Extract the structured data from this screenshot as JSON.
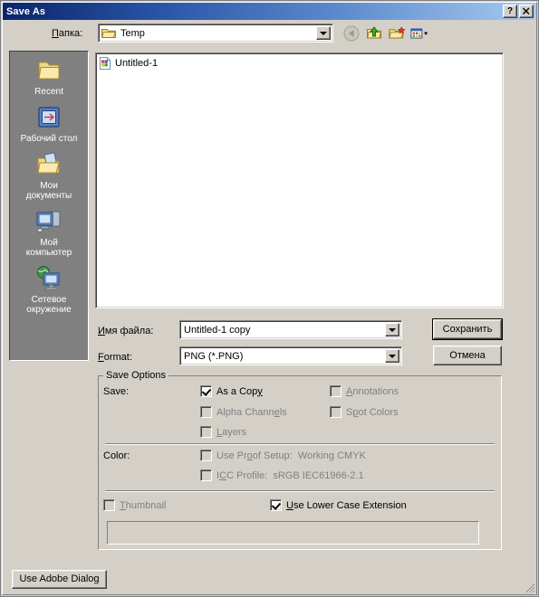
{
  "window": {
    "title": "Save As",
    "help_button": "?",
    "close_button": "✕"
  },
  "toolbar": {
    "lookin_label": "Папка:",
    "lookin_value": "Temp",
    "icons": [
      {
        "name": "back-icon",
        "title": "Back",
        "enabled": false
      },
      {
        "name": "up-one-level-icon",
        "title": "Up One Level",
        "enabled": true
      },
      {
        "name": "new-folder-icon",
        "title": "Create New Folder",
        "enabled": true
      },
      {
        "name": "views-icon",
        "title": "Views",
        "enabled": true
      }
    ]
  },
  "places": [
    {
      "label": "Recent",
      "icon": "recent-folder-icon"
    },
    {
      "label": "Рабочий стол",
      "icon": "desktop-icon"
    },
    {
      "label": "Мои\nдокументы",
      "icon": "my-documents-icon"
    },
    {
      "label": "Мой\nкомпьютер",
      "icon": "my-computer-icon"
    },
    {
      "label": "Сетевое\nокружение",
      "icon": "network-icon"
    }
  ],
  "places_lines": {
    "p0": [
      "Recent"
    ],
    "p1": [
      "Рабочий стол"
    ],
    "p2": [
      "Мои",
      "документы"
    ],
    "p3": [
      "Мой",
      "компьютер"
    ],
    "p4": [
      "Сетевое",
      "окружение"
    ]
  },
  "file_list": {
    "items": [
      {
        "name": "Untitled-1",
        "icon": "image-file-icon"
      }
    ]
  },
  "fields": {
    "filename_label": "Имя файла:",
    "filename_value": "Untitled-1 copy",
    "format_label": "Format:",
    "format_value": "PNG (*.PNG)"
  },
  "buttons": {
    "save": "Сохранить",
    "cancel": "Отмена",
    "use_adobe_dialog": "Use Adobe Dialog"
  },
  "save_options": {
    "legend": "Save Options",
    "save_label": "Save:",
    "color_label": "Color:",
    "checkboxes_save_col1": [
      {
        "label": "As a Copy",
        "checked": true,
        "enabled": true
      },
      {
        "label": "Alpha Channels",
        "checked": false,
        "enabled": false
      },
      {
        "label": "Layers",
        "checked": false,
        "enabled": false
      }
    ],
    "checkboxes_save_col2": [
      {
        "label": "Annotations",
        "checked": false,
        "enabled": false
      },
      {
        "label": "Spot Colors",
        "checked": false,
        "enabled": false
      }
    ],
    "checkboxes_color": [
      {
        "label": "Use Proof Setup:  Working CMYK",
        "checked": false,
        "enabled": false
      },
      {
        "label": "ICC Profile:  sRGB IEC61966-2.1",
        "checked": false,
        "enabled": false
      }
    ],
    "checkbox_thumbnail": {
      "label": "Thumbnail",
      "checked": false,
      "enabled": false
    },
    "checkbox_lowercase": {
      "label": "Use Lower Case Extension",
      "checked": true,
      "enabled": true
    }
  },
  "colors": {
    "face": "#d4d0c8",
    "title_start": "#0a246a",
    "title_end": "#a6caf0",
    "places_bg": "#808080",
    "list_bg": "#ffffff",
    "disabled_text": "#808080"
  }
}
